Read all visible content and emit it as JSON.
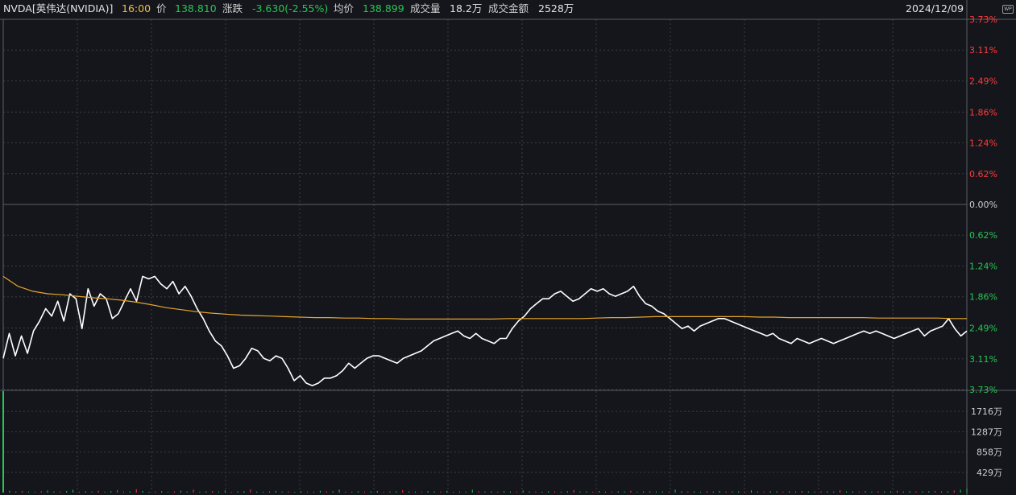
{
  "header": {
    "symbol": "NVDA[英伟达(NVIDIA)]",
    "time": "16:00",
    "price_label": "价",
    "price_value": "138.810",
    "change_label": "涨跌",
    "change_value": "-3.630(-2.55%)",
    "avg_label": "均价",
    "avg_value": "138.899",
    "volume_label": "成交量",
    "volume_value": "18.2万",
    "turnover_label": "成交金额",
    "turnover_value": "2528万",
    "date": "2024/12/09",
    "logo_text": "WP"
  },
  "colors": {
    "background": "#14161c",
    "up": "#ff3b3b",
    "down": "#27c653",
    "neutral": "#cfcfcf",
    "price_line": "#ffffff",
    "avg_line": "#e8a52a",
    "grid": "#3a3d44"
  },
  "chart_data": [
    {
      "type": "line",
      "ylim": [
        -3.73,
        3.73
      ],
      "y_ticks": [
        {
          "label": "3.73%",
          "value": 3.73,
          "color": "up"
        },
        {
          "label": "3.11%",
          "value": 3.11,
          "color": "up"
        },
        {
          "label": "2.49%",
          "value": 2.49,
          "color": "up"
        },
        {
          "label": "1.86%",
          "value": 1.86,
          "color": "up"
        },
        {
          "label": "1.24%",
          "value": 1.24,
          "color": "up"
        },
        {
          "label": "0.62%",
          "value": 0.62,
          "color": "up"
        },
        {
          "label": "0.00%",
          "value": 0.0,
          "color": "neutral"
        },
        {
          "label": "0.62%",
          "value": -0.62,
          "color": "down"
        },
        {
          "label": "1.24%",
          "value": -1.24,
          "color": "down"
        },
        {
          "label": "1.86%",
          "value": -1.86,
          "color": "down"
        },
        {
          "label": "2.49%",
          "value": -2.49,
          "color": "down"
        },
        {
          "label": "3.11%",
          "value": -3.11,
          "color": "down"
        },
        {
          "label": "3.73%",
          "value": -3.73,
          "color": "down"
        }
      ],
      "grid": true,
      "series": [
        {
          "color": "price_line",
          "values": [
            -3.1,
            -2.6,
            -3.05,
            -2.65,
            -3.0,
            -2.55,
            -2.35,
            -2.1,
            -2.25,
            -1.95,
            -2.35,
            -1.8,
            -1.9,
            -2.5,
            -1.7,
            -2.05,
            -1.8,
            -1.9,
            -2.3,
            -2.2,
            -1.95,
            -1.7,
            -1.95,
            -1.45,
            -1.5,
            -1.45,
            -1.6,
            -1.7,
            -1.55,
            -1.8,
            -1.65,
            -1.85,
            -2.1,
            -2.3,
            -2.55,
            -2.75,
            -2.85,
            -3.05,
            -3.3,
            -3.25,
            -3.1,
            -2.9,
            -2.95,
            -3.1,
            -3.15,
            -3.05,
            -3.1,
            -3.3,
            -3.55,
            -3.45,
            -3.6,
            -3.65,
            -3.6,
            -3.5,
            -3.5,
            -3.45,
            -3.35,
            -3.2,
            -3.3,
            -3.2,
            -3.1,
            -3.05,
            -3.05,
            -3.1,
            -3.15,
            -3.2,
            -3.1,
            -3.05,
            -3.0,
            -2.95,
            -2.85,
            -2.75,
            -2.7,
            -2.65,
            -2.6,
            -2.55,
            -2.65,
            -2.7,
            -2.6,
            -2.7,
            -2.75,
            -2.8,
            -2.7,
            -2.7,
            -2.5,
            -2.35,
            -2.25,
            -2.1,
            -2.0,
            -1.9,
            -1.9,
            -1.8,
            -1.75,
            -1.85,
            -1.95,
            -1.9,
            -1.8,
            -1.7,
            -1.75,
            -1.7,
            -1.8,
            -1.85,
            -1.8,
            -1.75,
            -1.65,
            -1.85,
            -2.0,
            -2.05,
            -2.15,
            -2.2,
            -2.3,
            -2.4,
            -2.5,
            -2.45,
            -2.55,
            -2.45,
            -2.4,
            -2.35,
            -2.3,
            -2.3,
            -2.35,
            -2.4,
            -2.45,
            -2.5,
            -2.55,
            -2.6,
            -2.65,
            -2.6,
            -2.7,
            -2.75,
            -2.8,
            -2.7,
            -2.75,
            -2.8,
            -2.75,
            -2.7,
            -2.75,
            -2.8,
            -2.75,
            -2.7,
            -2.65,
            -2.6,
            -2.55,
            -2.6,
            -2.55,
            -2.6,
            -2.65,
            -2.7,
            -2.65,
            -2.6,
            -2.55,
            -2.5,
            -2.65,
            -2.55,
            -2.5,
            -2.45,
            -2.3,
            -2.5,
            -2.65,
            -2.55
          ]
        },
        {
          "color": "avg_line",
          "values": [
            -1.45,
            -1.65,
            -1.75,
            -1.8,
            -1.82,
            -1.85,
            -1.88,
            -1.9,
            -1.93,
            -1.97,
            -2.02,
            -2.08,
            -2.12,
            -2.16,
            -2.19,
            -2.21,
            -2.23,
            -2.24,
            -2.25,
            -2.26,
            -2.27,
            -2.28,
            -2.28,
            -2.29,
            -2.29,
            -2.3,
            -2.3,
            -2.31,
            -2.31,
            -2.31,
            -2.31,
            -2.31,
            -2.31,
            -2.31,
            -2.3,
            -2.3,
            -2.3,
            -2.3,
            -2.3,
            -2.3,
            -2.29,
            -2.28,
            -2.28,
            -2.27,
            -2.26,
            -2.26,
            -2.26,
            -2.26,
            -2.26,
            -2.26,
            -2.26,
            -2.27,
            -2.27,
            -2.28,
            -2.28,
            -2.28,
            -2.28,
            -2.28,
            -2.28,
            -2.29,
            -2.29,
            -2.29,
            -2.29,
            -2.29,
            -2.3,
            -2.3
          ]
        }
      ]
    },
    {
      "type": "bar",
      "y_ticks": [
        {
          "label": "1716万",
          "value": 1716
        },
        {
          "label": "1287万",
          "value": 1287
        },
        {
          "label": "858万",
          "value": 858
        },
        {
          "label": "429万",
          "value": 429
        }
      ],
      "ylim": [
        0,
        2145
      ],
      "values": [
        2145,
        40,
        25,
        35,
        20,
        15,
        30,
        45,
        25,
        20,
        35,
        60,
        18,
        28,
        22,
        40,
        15,
        30,
        55,
        20,
        25,
        70,
        35,
        18,
        20,
        30,
        15,
        25,
        40,
        22,
        60,
        18,
        26,
        34,
        20,
        45,
        16,
        28,
        30,
        65,
        22,
        18,
        26,
        38,
        20,
        24,
        15,
        30,
        22,
        18,
        40,
        25,
        28,
        60,
        22,
        18,
        30,
        20,
        26,
        35,
        15,
        22,
        28,
        50,
        24,
        20,
        18,
        32,
        26,
        22,
        38,
        16,
        24,
        20,
        60,
        28,
        22,
        26,
        18,
        30,
        24,
        20,
        45,
        26,
        22,
        18,
        30,
        24,
        20,
        28,
        55,
        22,
        26,
        18,
        34,
        20,
        24,
        28,
        22,
        40,
        18,
        26,
        30,
        22,
        24,
        20,
        60,
        28,
        22,
        26,
        18,
        30,
        24,
        35,
        22,
        26,
        28,
        20,
        45,
        24,
        22,
        30,
        26,
        20,
        28,
        22,
        34,
        24,
        20,
        26,
        28,
        22,
        50,
        24,
        26,
        20,
        30,
        22,
        28,
        24,
        26,
        40,
        22,
        30,
        24,
        26,
        28,
        35,
        24,
        30,
        45,
        60,
        80
      ]
    }
  ]
}
